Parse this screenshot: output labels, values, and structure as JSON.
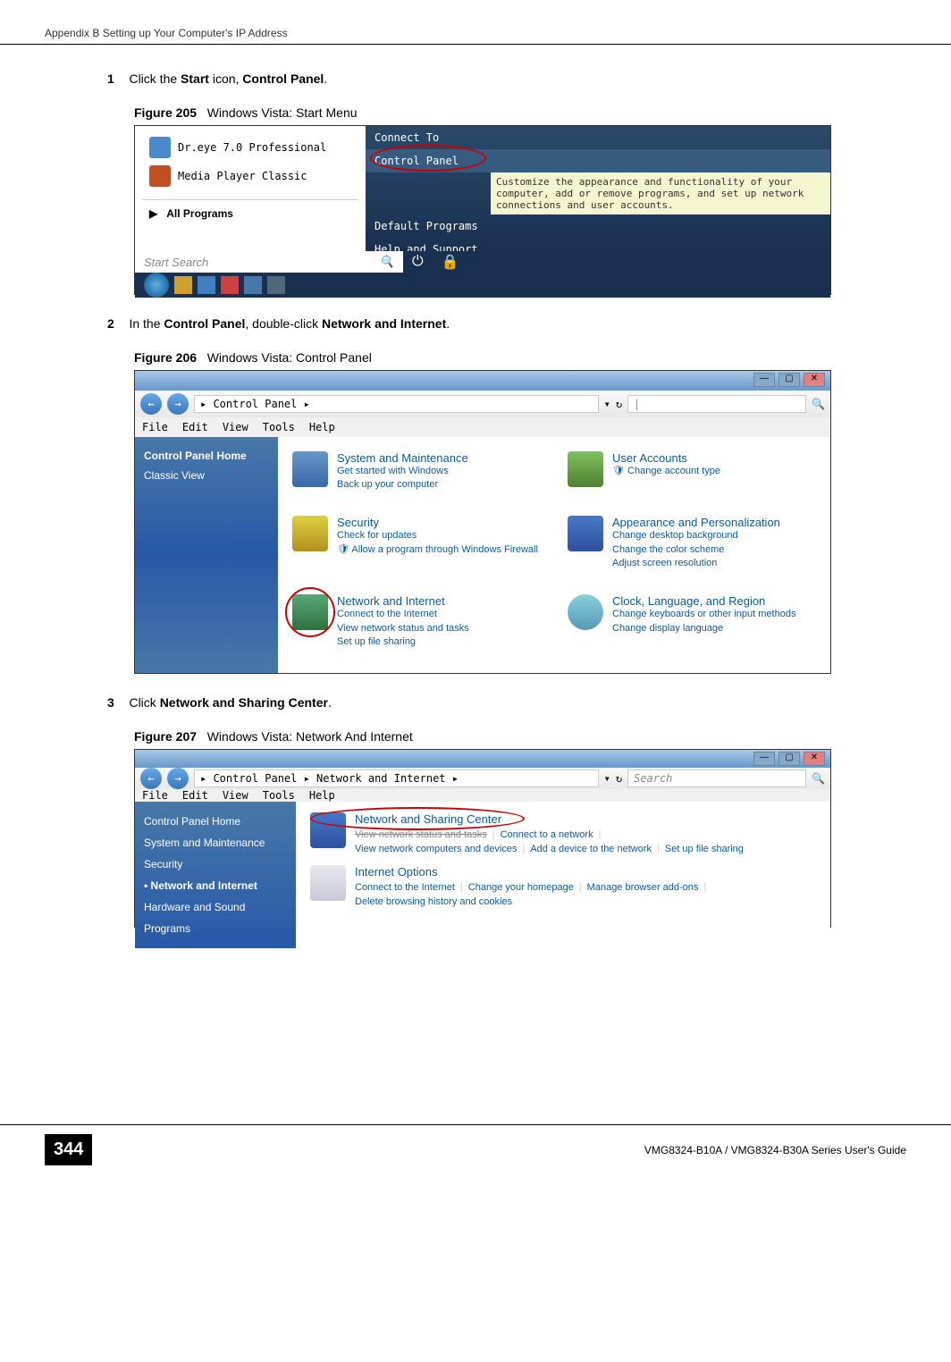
{
  "header": {
    "appendix": "Appendix B Setting up Your Computer's IP Address"
  },
  "step1": {
    "num": "1",
    "text_a": "Click the ",
    "text_b": "Start",
    "text_c": " icon, ",
    "text_d": "Control Panel",
    "text_e": "."
  },
  "fig205": {
    "label": "Figure 205",
    "caption": "Windows Vista: Start Menu",
    "apps": {
      "dreye": "Dr.eye 7.0 Professional",
      "media": "Media Player Classic"
    },
    "all_programs": "All Programs",
    "menu": {
      "connect": "Connect To",
      "control_panel": "Control Panel",
      "default_programs": "Default Programs",
      "help": "Help and Support"
    },
    "tooltip": "Customize the appearance and functionality of your computer, add or remove programs, and set up network connections and user accounts.",
    "search_placeholder": "Start Search"
  },
  "step2": {
    "num": "2",
    "text_a": "In the ",
    "text_b": "Control Panel",
    "text_c": ", double-click ",
    "text_d": "Network and Internet",
    "text_e": "."
  },
  "fig206": {
    "label": "Figure 206",
    "caption": "Windows Vista: Control Panel",
    "breadcrumb": "▸ Control Panel ▸",
    "search": "|",
    "menu": {
      "file": "File",
      "edit": "Edit",
      "view": "View",
      "tools": "Tools",
      "help": "Help"
    },
    "sidebar": {
      "home": "Control Panel Home",
      "classic": "Classic View"
    },
    "cats": {
      "system": {
        "title": "System and Maintenance",
        "l1": "Get started with Windows",
        "l2": "Back up your computer"
      },
      "users": {
        "title": "User Accounts",
        "l1": "Change account type"
      },
      "security": {
        "title": "Security",
        "l1": "Check for updates",
        "l2": "Allow a program through Windows Firewall"
      },
      "appearance": {
        "title": "Appearance and Personalization",
        "l1": "Change desktop background",
        "l2": "Change the color scheme",
        "l3": "Adjust screen resolution"
      },
      "network": {
        "title": "Network and Internet",
        "l1": "Connect to the Internet",
        "l2": "View network status and tasks",
        "l3": "Set up file sharing"
      },
      "clock": {
        "title": "Clock, Language, and Region",
        "l1": "Change keyboards or other input methods",
        "l2": "Change display language"
      }
    }
  },
  "step3": {
    "num": "3",
    "text_a": "Click ",
    "text_b": "Network and Sharing Center",
    "text_c": "."
  },
  "fig207": {
    "label": "Figure 207",
    "caption": "Windows Vista: Network And Internet",
    "breadcrumb": "▸ Control Panel ▸ Network and Internet ▸",
    "search": "Search",
    "menu": {
      "file": "File",
      "edit": "Edit",
      "view": "View",
      "tools": "Tools",
      "help": "Help"
    },
    "sidebar": {
      "home": "Control Panel Home",
      "system": "System and Maintenance",
      "security": "Security",
      "network": "Network and Internet",
      "hardware": "Hardware and Sound",
      "programs": "Programs"
    },
    "cats": {
      "sharing": {
        "title": "Network and Sharing Center",
        "l1": "View network status and tasks",
        "l2": "Connect to a network",
        "l3": "View network computers and devices",
        "l4": "Add a device to the network",
        "l5": "Set up file sharing"
      },
      "internet": {
        "title": "Internet Options",
        "l1": "Connect to the Internet",
        "l2": "Change your homepage",
        "l3": "Manage browser add-ons",
        "l4": "Delete browsing history and cookies"
      }
    }
  },
  "footer": {
    "page": "344",
    "text": "VMG8324-B10A / VMG8324-B30A Series User's Guide"
  }
}
